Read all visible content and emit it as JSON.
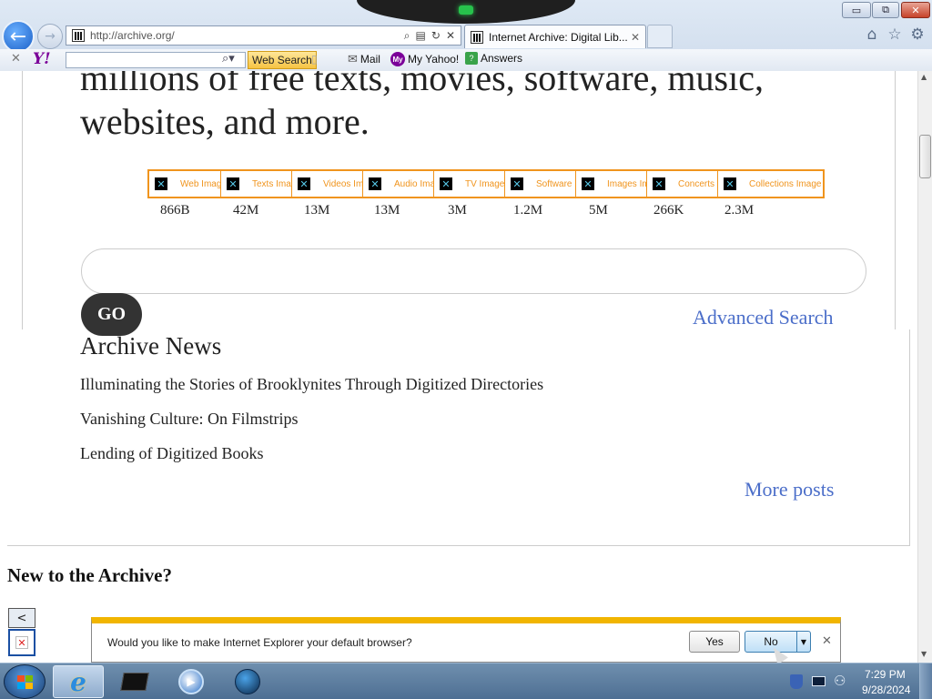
{
  "browser": {
    "address_url": "http://archive.org/",
    "tab_title": "Internet Archive: Digital Lib...",
    "window_controls": {
      "minimize": "▭",
      "maximize": "⧉",
      "close": "✕"
    },
    "yahoo_toolbar": {
      "logo": "Y!",
      "search_button": "Web Search",
      "mail": "Mail",
      "my_yahoo": "My Yahoo!",
      "answers": "Answers"
    }
  },
  "page": {
    "tagline_line1": "millions of free texts, movies, software, music,",
    "tagline_line2": "websites, and more.",
    "media_types": [
      {
        "alt": "Web Image",
        "count": "866B"
      },
      {
        "alt": "Texts Image",
        "count": "42M"
      },
      {
        "alt": "Videos Image",
        "count": "13M"
      },
      {
        "alt": "Audio Image",
        "count": "13M"
      },
      {
        "alt": "TV Image",
        "count": "3M"
      },
      {
        "alt": "Software Image",
        "count": "1.2M"
      },
      {
        "alt": "Images Image",
        "count": "5M"
      },
      {
        "alt": "Concerts Image",
        "count": "266K"
      },
      {
        "alt": "Collections Image",
        "count": "2.3M"
      }
    ],
    "search_placeholder": "",
    "go_label": "GO",
    "advanced_search": "Advanced Search",
    "news_title": "Archive News",
    "news_items": [
      "Illuminating the Stories of Brooklynites Through Digitized Directories",
      "Vanishing Culture: On Filmstrips",
      "Lending of Digitized Books"
    ],
    "more_posts": "More posts",
    "new_heading": "New to the Archive?",
    "carousel_prev": "<"
  },
  "notification": {
    "message": "Would you like to make Internet Explorer your default browser?",
    "yes_label": "Yes",
    "no_label": "No"
  },
  "taskbar": {
    "clock_time": "7:29 PM",
    "clock_date": "9/28/2024"
  },
  "colors": {
    "link": "#4b6ec9",
    "media_border": "#f0941d",
    "notification_accent": "#f1b500"
  }
}
